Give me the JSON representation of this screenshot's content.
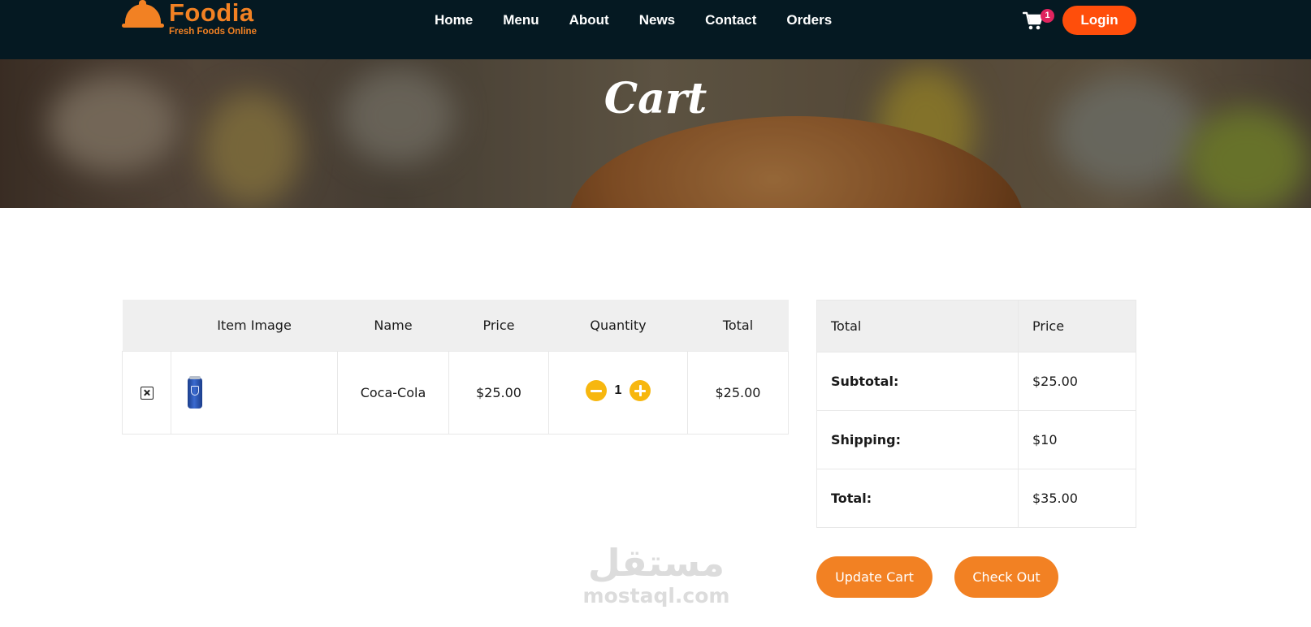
{
  "brand": {
    "name": "Foodia",
    "tagline": "Fresh Foods Online",
    "color": "#F28123"
  },
  "nav": {
    "links": [
      "Home",
      "Menu",
      "About",
      "News",
      "Contact",
      "Orders"
    ],
    "cart_count": "1",
    "login_label": "Login"
  },
  "hero": {
    "title": "Cart"
  },
  "cart": {
    "headers": [
      "",
      "Item Image",
      "Name",
      "Price",
      "Quantity",
      "Total"
    ],
    "rows": [
      {
        "name": "Coca-Cola",
        "price": "$25.00",
        "quantity": "1",
        "total": "$25.00"
      }
    ]
  },
  "totals": {
    "headers": [
      "Total",
      "Price"
    ],
    "rows": [
      {
        "label": "Subtotal:",
        "value": "$25.00"
      },
      {
        "label": "Shipping:",
        "value": "$10"
      },
      {
        "label": "Total:",
        "value": "$35.00"
      }
    ]
  },
  "actions": {
    "update_label": "Update Cart",
    "checkout_label": "Check Out"
  },
  "watermark": {
    "arabic": "مستقل",
    "latin": "mostaql.com"
  },
  "icons": {
    "logo": "cloche-icon",
    "cart": "shopping-cart-icon",
    "remove": "close-box-icon",
    "decrease": "minus-circle-icon",
    "increase": "plus-circle-icon"
  }
}
